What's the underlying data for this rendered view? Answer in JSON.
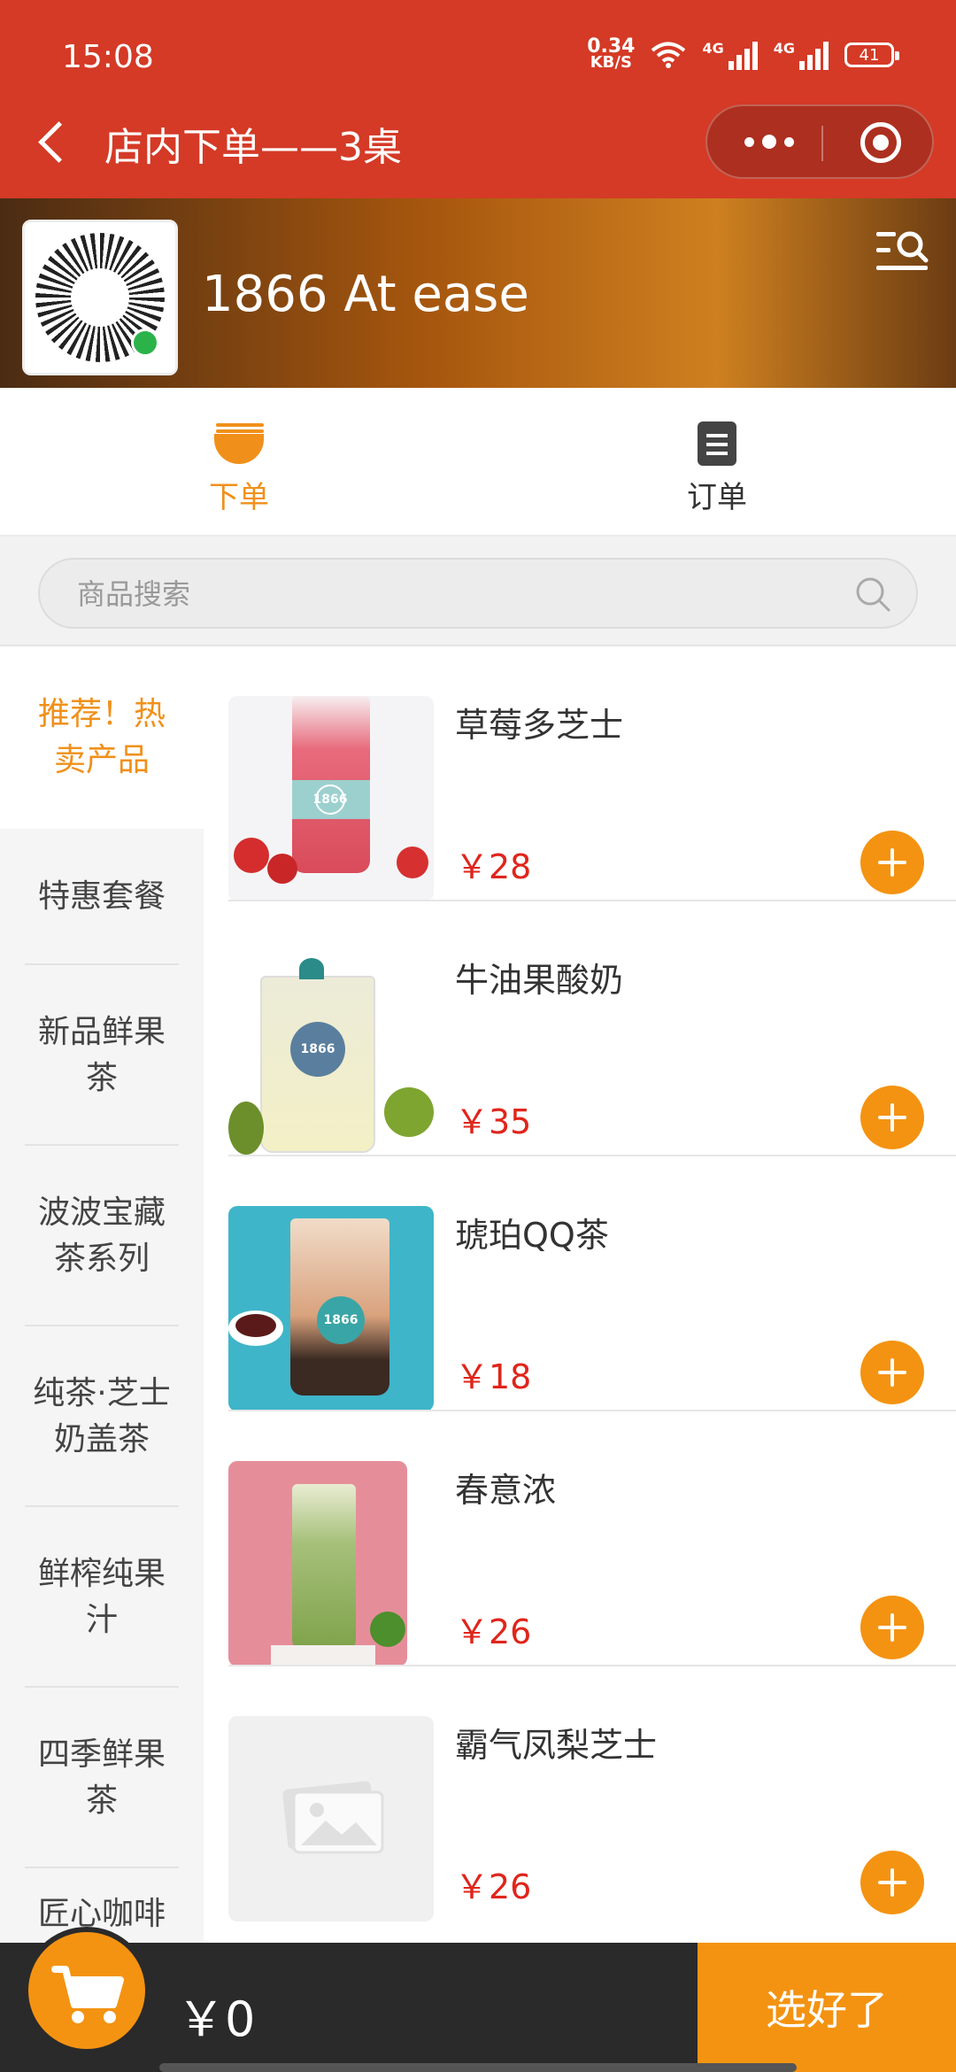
{
  "status_bar": {
    "time": "15:08",
    "net_speed_value": "0.34",
    "net_speed_unit": "KB/S",
    "signal1_label": "4G",
    "signal2_label": "4G",
    "battery": "41"
  },
  "nav": {
    "title": "店内下单——3桌"
  },
  "store": {
    "name": "1866 At ease"
  },
  "tabs": [
    {
      "label": "下单",
      "active": true
    },
    {
      "label": "订单",
      "active": false
    }
  ],
  "search": {
    "placeholder": "商品搜索"
  },
  "categories": [
    {
      "label": "推荐！热卖产品",
      "active": true
    },
    {
      "label": "特惠套餐",
      "active": false
    },
    {
      "label": "新品鲜果茶",
      "active": false
    },
    {
      "label": "波波宝藏茶系列",
      "active": false
    },
    {
      "label": "纯茶·芝士奶盖茶",
      "active": false
    },
    {
      "label": "鲜榨纯果汁",
      "active": false
    },
    {
      "label": "四季鲜果茶",
      "active": false
    },
    {
      "label": "匠心咖啡",
      "active": false
    }
  ],
  "products": [
    {
      "name": "草莓多芝士",
      "price": "￥28",
      "image": "strawberry-cheese-drink"
    },
    {
      "name": "牛油果酸奶",
      "price": "￥35",
      "image": "avocado-yogurt-drink"
    },
    {
      "name": "琥珀QQ茶",
      "price": "￥18",
      "image": "amber-boba-tea"
    },
    {
      "name": "春意浓",
      "price": "￥26",
      "image": "kiwi-green-drink"
    },
    {
      "name": "霸气凤梨芝士",
      "price": "￥26",
      "image": "placeholder-image"
    }
  ],
  "cart": {
    "total": "￥0",
    "checkout_label": "选好了"
  },
  "colors": {
    "header_red": "#d43a26",
    "accent_orange": "#f49311",
    "price_red": "#e0251b",
    "cart_bar": "#2a2a2a"
  }
}
